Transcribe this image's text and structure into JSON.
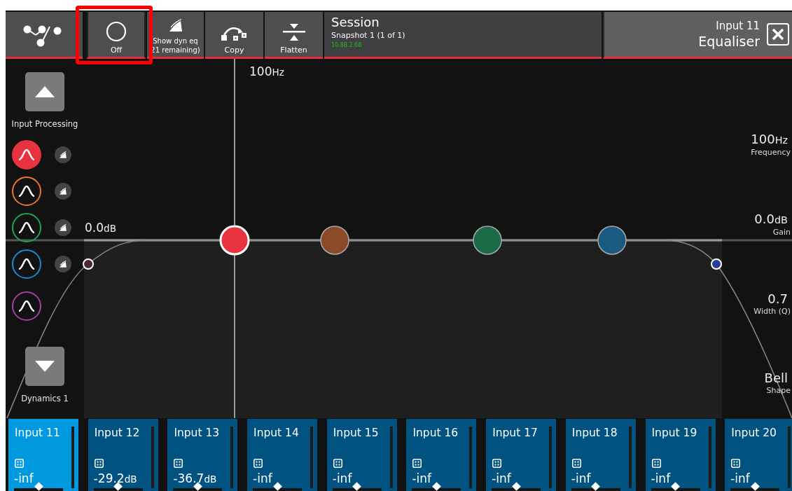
{
  "toolbar": [
    {
      "kind": "logo"
    },
    {
      "kind": "toggle",
      "label": "Off",
      "on": false,
      "highlighted": true
    },
    {
      "kind": "dyn",
      "lines": [
        "Show dyn eq",
        "21 remaining)"
      ]
    },
    {
      "kind": "copy",
      "label": "Copy"
    },
    {
      "kind": "flatten",
      "label": "Flatten"
    }
  ],
  "session": {
    "title": "Session",
    "snapshot": "Snapshot 1 (1 of 1)",
    "address": "10.88.2.68"
  },
  "header": {
    "channel": "Input 11",
    "title": "Equaliser"
  },
  "sidebar": {
    "up_label": "Input Processing",
    "down_label": "Dynamics 1",
    "bands": [
      {
        "color": "#e8323f",
        "selected": true,
        "dynamic": true
      },
      {
        "color": "#e8772e",
        "selected": false,
        "dynamic": true
      },
      {
        "color": "#1aa55a",
        "selected": false,
        "dynamic": true
      },
      {
        "color": "#1a8ad0",
        "selected": false,
        "dynamic": true
      },
      {
        "color": "#a040a0",
        "selected": false,
        "dynamic": false
      }
    ]
  },
  "graph": {
    "freq_label": {
      "value": "100",
      "unit": "Hz"
    },
    "gain_label": {
      "value": "0.0",
      "unit": "dB"
    },
    "nodes": [
      {
        "kind": "band",
        "color": "#e8323f",
        "selected": true
      },
      {
        "kind": "band",
        "color": "#8a4a2a",
        "selected": false
      },
      {
        "kind": "band",
        "color": "#1a6a45",
        "selected": false
      },
      {
        "kind": "band",
        "color": "#1a5a80",
        "selected": false
      },
      {
        "kind": "filter",
        "color": "#4a2a3a",
        "selected": false
      },
      {
        "kind": "filter",
        "color": "#2a3a9a",
        "selected": false
      }
    ]
  },
  "parameters": [
    {
      "value": "100",
      "unit": "Hz",
      "label": "Frequency"
    },
    {
      "value": "0.0",
      "unit": "dB",
      "label": "Gain"
    },
    {
      "value": "0.7",
      "label": "Width (Q)"
    },
    {
      "value": "Bell",
      "label": "Shape"
    }
  ],
  "channels": [
    {
      "name": "Input 11",
      "value": "-inf",
      "selected": true,
      "level": 0.5
    },
    {
      "name": "Input 12",
      "value": "-29.2",
      "unit": "dB",
      "selected": false,
      "level": 0.5
    },
    {
      "name": "Input 13",
      "value": "-36.7",
      "unit": "dB",
      "selected": false,
      "level": 0.5
    },
    {
      "name": "Input 14",
      "value": "-inf",
      "selected": false,
      "level": 0.5
    },
    {
      "name": "Input 15",
      "value": "-inf",
      "selected": false,
      "level": 0.5
    },
    {
      "name": "Input 16",
      "value": "-inf",
      "selected": false,
      "level": 0.5
    },
    {
      "name": "Input 17",
      "value": "-inf",
      "selected": false,
      "level": 0.5
    },
    {
      "name": "Input 18",
      "value": "-inf",
      "selected": false,
      "level": 0.5
    },
    {
      "name": "Input 19",
      "value": "-inf",
      "selected": false,
      "level": 0.5
    },
    {
      "name": "Input 20",
      "value": "-inf",
      "selected": false,
      "level": 0.5
    }
  ]
}
